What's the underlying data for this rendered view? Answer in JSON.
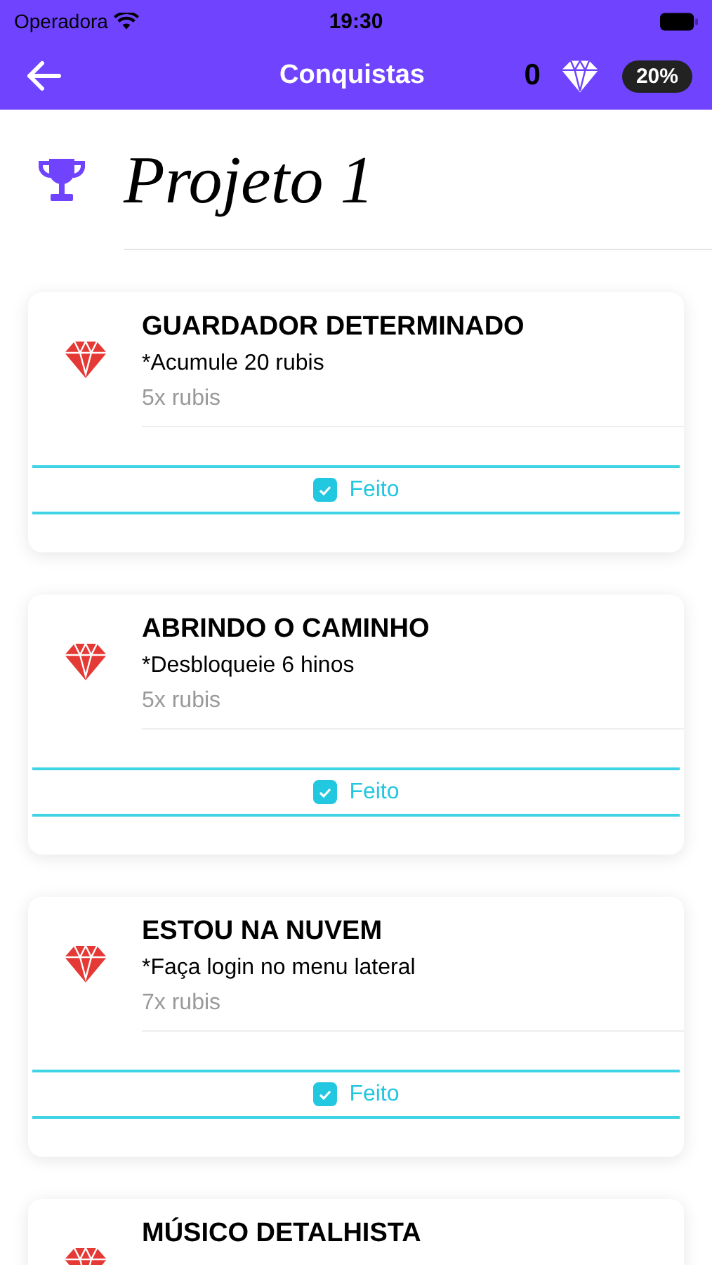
{
  "status_bar": {
    "carrier": "Operadora",
    "time": "19:30"
  },
  "header": {
    "title": "Conquistas",
    "gems": "0",
    "percent": "20%"
  },
  "project": {
    "title": "Projeto 1"
  },
  "achievements": [
    {
      "title": "GUARDADOR DETERMINADO",
      "description": "*Acumule 20 rubis",
      "reward": "5x rubis",
      "done": {
        "label": "Feito",
        "checked": true
      }
    },
    {
      "title": "ABRINDO O CAMINHO",
      "description": "*Desbloqueie 6 hinos",
      "reward": "5x rubis",
      "done": {
        "label": "Feito",
        "checked": true
      }
    },
    {
      "title": "ESTOU NA NUVEM",
      "description": "*Faça login no menu lateral",
      "reward": "7x rubis",
      "done": {
        "label": "Feito",
        "checked": true
      }
    },
    {
      "title": "MÚSICO DETALHISTA"
    }
  ]
}
